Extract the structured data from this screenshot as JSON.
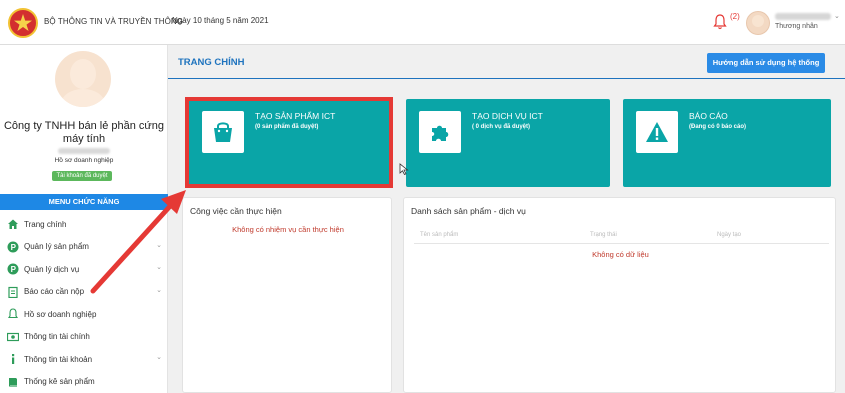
{
  "header": {
    "ministry": "BỘ THÔNG TIN VÀ TRUYỀN THÔNG",
    "date": "Ngày 10 tháng 5 năm 2021",
    "notification_count": "(2)",
    "user_role": "Thương nhân"
  },
  "sidebar": {
    "company_name": "Công ty TNHH bán lẻ phần cứng máy tính",
    "profile_label": "Hồ sơ doanh nghiệp",
    "verified_badge": "Tài khoản đã duyệt",
    "menu_title": "MENU CHỨC NĂNG",
    "items": [
      {
        "label": "Trang chính",
        "icon": "home-icon"
      },
      {
        "label": "Quản lý sản phẩm",
        "icon": "p-circle-icon"
      },
      {
        "label": "Quản lý dịch vụ",
        "icon": "p-circle-icon"
      },
      {
        "label": "Báo cáo cần nộp",
        "icon": "clipboard-icon"
      },
      {
        "label": "Hồ sơ doanh nghiệp",
        "icon": "bell-icon"
      },
      {
        "label": "Thông tin tài chính",
        "icon": "money-icon"
      },
      {
        "label": "Thông tin tài khoản",
        "icon": "info-icon"
      },
      {
        "label": "Thống kê sản phẩm",
        "icon": "book-icon"
      }
    ]
  },
  "main": {
    "page_title": "TRANG CHÍNH",
    "guide_button": "Hướng dẫn sử dụng hệ thống",
    "tiles": [
      {
        "title": "TẠO SẢN PHẨM ICT",
        "subtitle": "(0 sản phẩm đã duyệt)",
        "icon": "shopping-bag-icon"
      },
      {
        "title": "TẠO DỊCH VỤ ICT",
        "subtitle": "( 0 dịch vụ đã duyệt)",
        "icon": "puzzle-icon"
      },
      {
        "title": "BÁO CÁO",
        "subtitle": "(Đang có 0 báo cáo)",
        "icon": "warning-icon"
      }
    ],
    "tasks_panel": {
      "title": "Công việc cần thực hiện",
      "empty": "Không có nhiệm vụ cần thực hiện"
    },
    "products_panel": {
      "title": "Danh sách sản phẩm - dịch vụ",
      "columns": [
        "Tên sản phẩm",
        "Trạng thái",
        "Ngày tạo"
      ],
      "empty": "Không có dữ liệu"
    }
  },
  "colors": {
    "accent": "#1e88e5",
    "tile": "#0aa5a7",
    "highlight": "#e53935"
  }
}
